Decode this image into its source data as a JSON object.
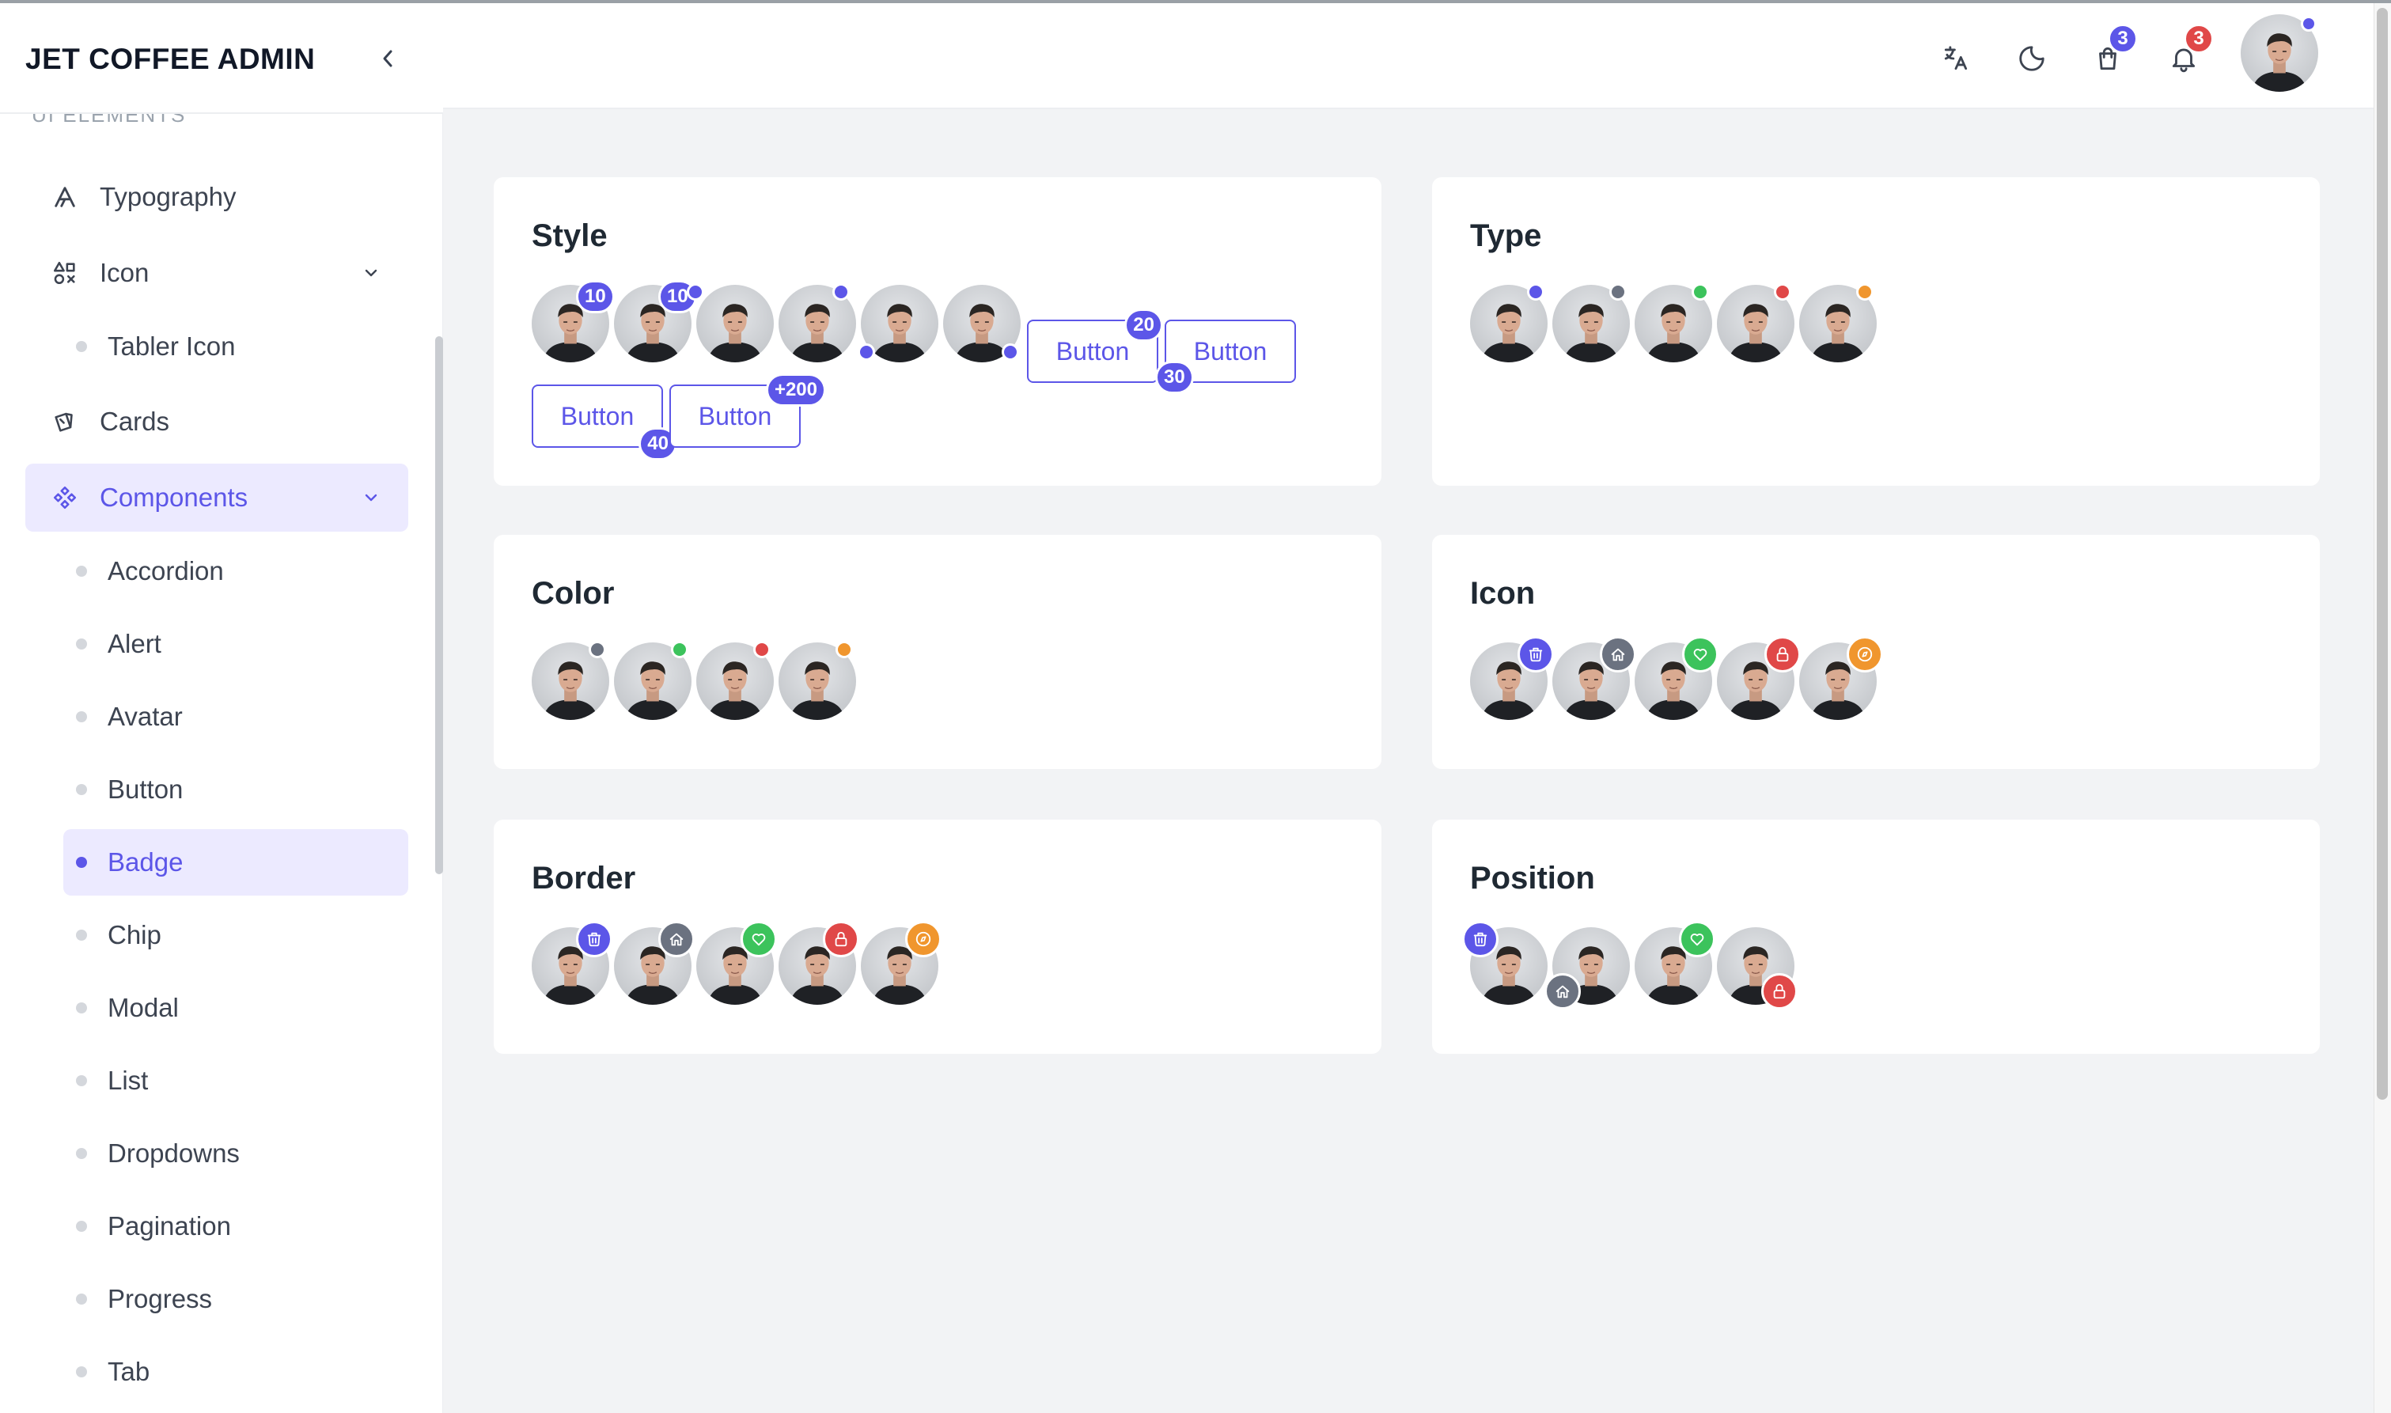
{
  "brand": {
    "title": "JET COFFEE ADMIN"
  },
  "sidebar": {
    "section_label": "UI ELEMENTS",
    "typography": "Typography",
    "icon": "Icon",
    "tabler_icon": "Tabler Icon",
    "cards": "Cards",
    "components": "Components",
    "sub_items": [
      "Accordion",
      "Alert",
      "Avatar",
      "Button",
      "Badge",
      "Chip",
      "Modal",
      "List",
      "Dropdowns",
      "Pagination",
      "Progress",
      "Tab"
    ],
    "active_sub_item": "Badge"
  },
  "header": {
    "cart_count": "3",
    "notification_count": "3",
    "icons": [
      "translate-icon",
      "moon-icon",
      "shopping-bag-icon",
      "bell-icon"
    ]
  },
  "cards": {
    "style": {
      "title": "Style",
      "badges": [
        "10",
        "10"
      ],
      "buttons": [
        {
          "label": "Button",
          "badge": "20"
        },
        {
          "label": "Button",
          "badge": "30"
        },
        {
          "label": "Button",
          "badge": "40"
        },
        {
          "label": "Button",
          "badge": "+200"
        }
      ]
    },
    "type": {
      "title": "Type"
    },
    "color": {
      "title": "Color"
    },
    "icon": {
      "title": "Icon"
    },
    "border": {
      "title": "Border"
    },
    "position": {
      "title": "Position"
    }
  },
  "colors": {
    "primary": "#5c56e8",
    "secondary": "#6b7280",
    "success": "#3cc35c",
    "danger": "#e04848",
    "warning": "#f0962e"
  }
}
